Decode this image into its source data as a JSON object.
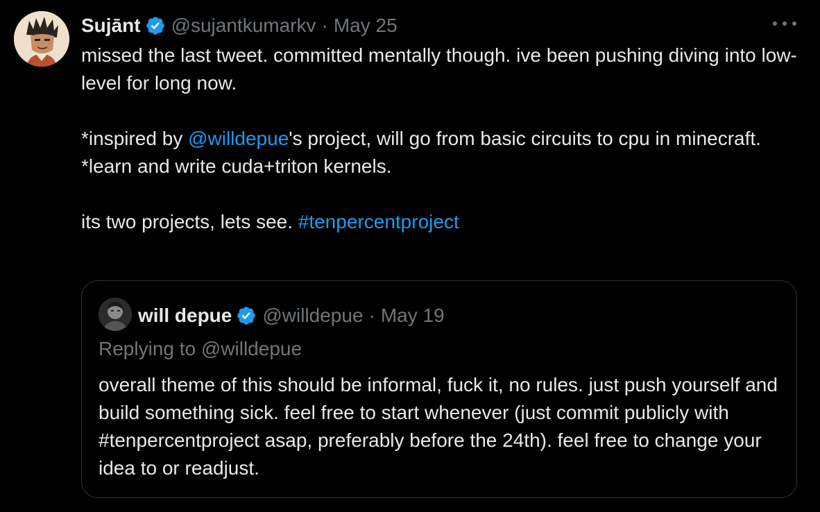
{
  "tweet": {
    "author_name": "Sujānt",
    "handle": "@sujantkumarkv",
    "separator": "·",
    "date": "May 25",
    "more_icon": "more-dots-icon",
    "lines": [
      {
        "before": "missed the last tweet. committed mentally though. ive been pushing diving into low-level for long now."
      },
      {
        "blank": true
      },
      {
        "before": "*inspired by ",
        "link": "@willdepue",
        "after": "'s project, will go from basic circuits to cpu in minecraft."
      },
      {
        "before": "*learn and write cuda+triton kernels."
      },
      {
        "blank": true
      },
      {
        "before": "its two projects, lets see. ",
        "link": "#tenpercentproject"
      }
    ]
  },
  "quote": {
    "author_name": "will depue",
    "handle": "@willdepue",
    "separator": "·",
    "date": "May 19",
    "replying_to": "Replying to @willdepue",
    "text": "overall theme of this should be informal, fuck it, no rules. just push yourself and build something sick. feel free to start whenever (just commit publicly with #tenpercentproject asap, preferably before the 24th). feel free to change your idea to or readjust."
  },
  "colors": {
    "background": "#000000",
    "text": "#e7e9ea",
    "muted": "#71767b",
    "link": "#1d9bf0",
    "border": "#2f3336",
    "verified": "#1d9bf0"
  }
}
